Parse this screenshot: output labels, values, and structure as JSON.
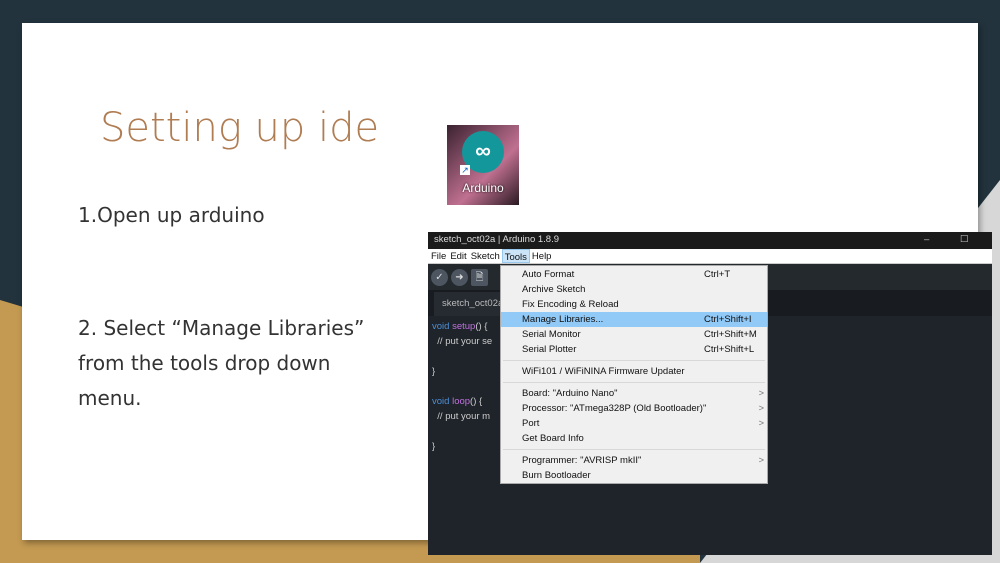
{
  "slide": {
    "title": "Setting up ide",
    "step1": "1.Open up arduino",
    "step2_lines": [
      "2. Select “Manage Libraries”",
      "from the tools drop down",
      "menu."
    ]
  },
  "desktop_icon": {
    "label": "Arduino",
    "glyph": "∞"
  },
  "ide": {
    "window_title": "sketch_oct02a | Arduino 1.8.9",
    "window_controls": [
      "–",
      "☐"
    ],
    "menubar": [
      "File",
      "Edit",
      "Sketch",
      "Tools",
      "Help"
    ],
    "toolbar": [
      "✓",
      "➜",
      "🗎"
    ],
    "tab": "sketch_oct02a",
    "code": {
      "setup_kw": "void",
      "setup_fn": "setup",
      "setup_rest": "() {",
      "comment1": "  // put your se",
      "close1": "}",
      "loop_kw": "void",
      "loop_fn": "loop",
      "loop_rest": "() {",
      "comment2": "  // put your m",
      "close2": "}"
    },
    "tools_menu": {
      "group1": [
        {
          "label": "Auto Format",
          "shortcut": "Ctrl+T"
        },
        {
          "label": "Archive Sketch",
          "shortcut": ""
        },
        {
          "label": "Fix Encoding & Reload",
          "shortcut": ""
        },
        {
          "label": "Manage Libraries...",
          "shortcut": "Ctrl+Shift+I"
        },
        {
          "label": "Serial Monitor",
          "shortcut": "Ctrl+Shift+M"
        },
        {
          "label": "Serial Plotter",
          "shortcut": "Ctrl+Shift+L"
        }
      ],
      "group2": [
        {
          "label": "WiFi101 / WiFiNINA Firmware Updater"
        }
      ],
      "group3": [
        {
          "label": "Board: \"Arduino Nano\"",
          "arrow": ">"
        },
        {
          "label": "Processor: \"ATmega328P (Old Bootloader)\"",
          "arrow": ">"
        },
        {
          "label": "Port",
          "arrow": ">"
        },
        {
          "label": "Get Board Info",
          "arrow": ""
        }
      ],
      "group4": [
        {
          "label": "Programmer: \"AVRISP mkII\"",
          "arrow": ">"
        },
        {
          "label": "Burn Bootloader",
          "arrow": ""
        }
      ]
    }
  }
}
